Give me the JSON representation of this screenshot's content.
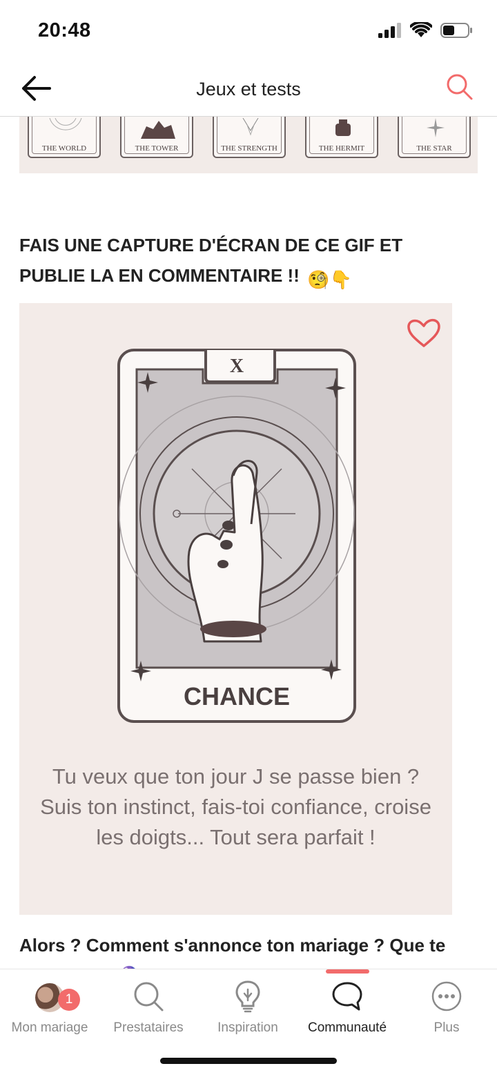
{
  "status_bar": {
    "time": "20:48"
  },
  "header": {
    "title": "Jeux et tests",
    "back_icon": "arrow-left-icon",
    "search_icon": "search-icon",
    "accent_color": "#f26b6b"
  },
  "tarot_strip": {
    "cards": [
      {
        "label": "THE WORLD"
      },
      {
        "label": "THE TOWER"
      },
      {
        "label": "THE STRENGTH"
      },
      {
        "label": "THE HERMIT"
      },
      {
        "label": "THE STAR"
      }
    ]
  },
  "post": {
    "heading": "FAIS UNE CAPTURE D'ÉCRAN DE CE GIF ET PUBLIE LA EN COMMENTAIRE !!",
    "heading_emojis": "🧐👇",
    "gif": {
      "card_number": "X",
      "card_title": "CHANCE",
      "caption": "Tu veux que ton jour J se passe bien ? Suis ton instinct, fais-toi confiance, croise les doigts... Tout sera parfait !",
      "heart_icon": "heart-icon"
    },
    "question": "Alors ? Comment s'annonce ton mariage ? Que te prédit-on ? 🔮"
  },
  "bottom_nav": {
    "items": [
      {
        "label": "Mon mariage",
        "icon": "avatar",
        "badge": "1"
      },
      {
        "label": "Prestataires",
        "icon": "search-icon"
      },
      {
        "label": "Inspiration",
        "icon": "lightbulb-icon"
      },
      {
        "label": "Communauté",
        "icon": "chat-bubble-icon",
        "active": true
      },
      {
        "label": "Plus",
        "icon": "more-dots-icon"
      }
    ]
  }
}
